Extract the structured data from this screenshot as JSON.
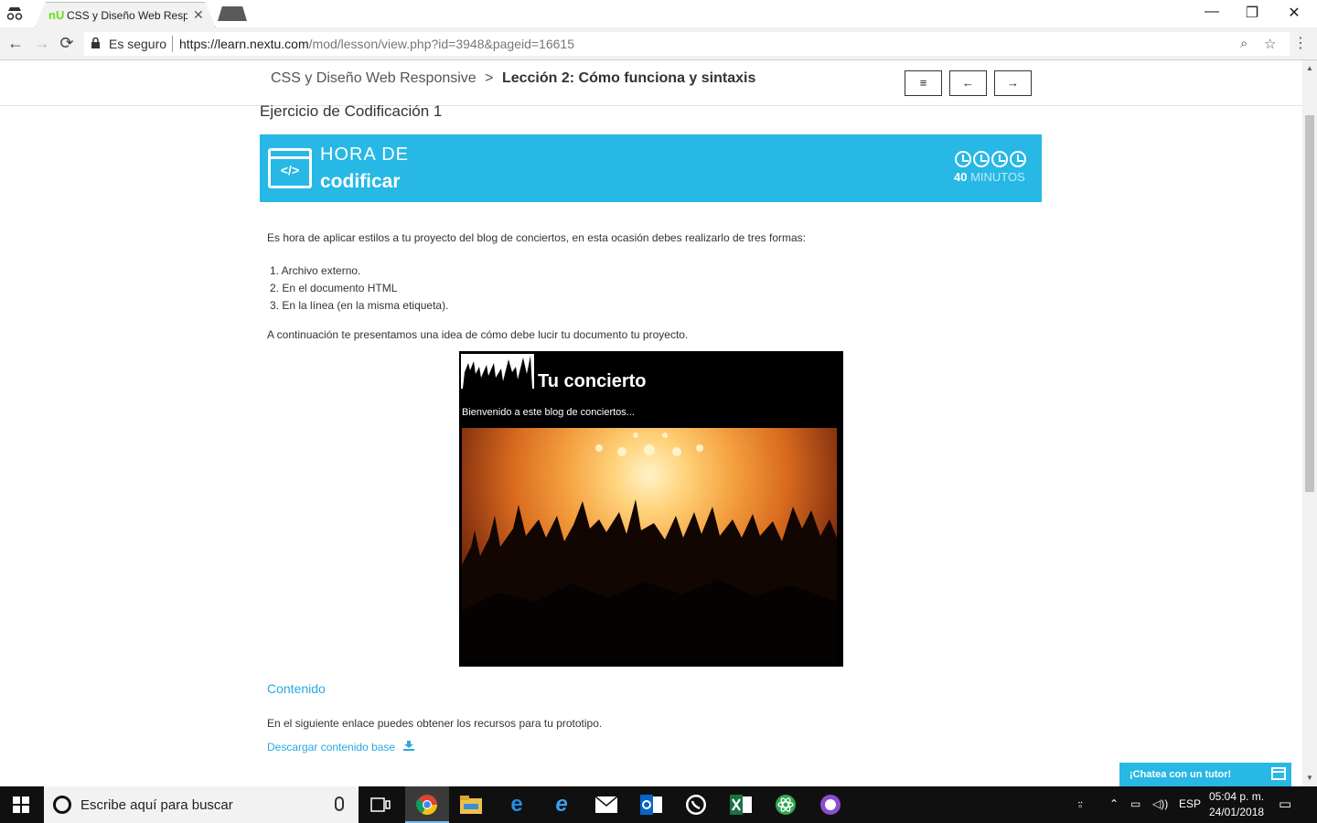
{
  "browser": {
    "tab_title": "CSS y Diseño Web Responsive",
    "tab_favicon": "nU",
    "secure_label": "Es seguro",
    "url_host": "https://learn.nextu.com",
    "url_path": "/mod/lesson/view.php?id=3948&pageid=16615",
    "window_controls": {
      "minimize": "—",
      "restore": "❐",
      "close": "✕"
    }
  },
  "header": {
    "course": "CSS y Diseño Web Responsive",
    "separator": ">",
    "lesson": "Lección 2: Cómo funciona y sintaxis",
    "buttons": {
      "menu": "≡",
      "prev": "←",
      "next": "→"
    }
  },
  "exercise_title": "Ejercicio de Codificación 1",
  "banner": {
    "icon_text": "</>",
    "line1": "HORA DE",
    "line2": "codificar",
    "minutes_number": "40",
    "minutes_label": "MINUTOS",
    "accent_color": "#27b8e5"
  },
  "content": {
    "intro": "Es hora de aplicar estilos a tu proyecto del blog de conciertos, en esta ocasión debes realizarlo de tres formas:",
    "list": [
      "1. Archivo externo.",
      "2. En el documento HTML",
      "3. En la línea (en la misma etiqueta)."
    ],
    "continuation": "A continuación te presentamos una idea de cómo debe lucir tu documento tu proyecto.",
    "demo_title": "Tu concierto",
    "demo_subtitle": "Bienvenido a este blog de conciertos...",
    "section_heading": "Contenido",
    "resources_text": "En el siguiente enlace puedes obtener los recursos para tu prototipo.",
    "download_link": "Descargar contenido base"
  },
  "chat": {
    "label": "¡Chatea con un tutor!"
  },
  "taskbar": {
    "search_placeholder": "Escribe aquí para buscar",
    "language": "ESP",
    "time": "05:04 p. m.",
    "date": "24/01/2018"
  }
}
